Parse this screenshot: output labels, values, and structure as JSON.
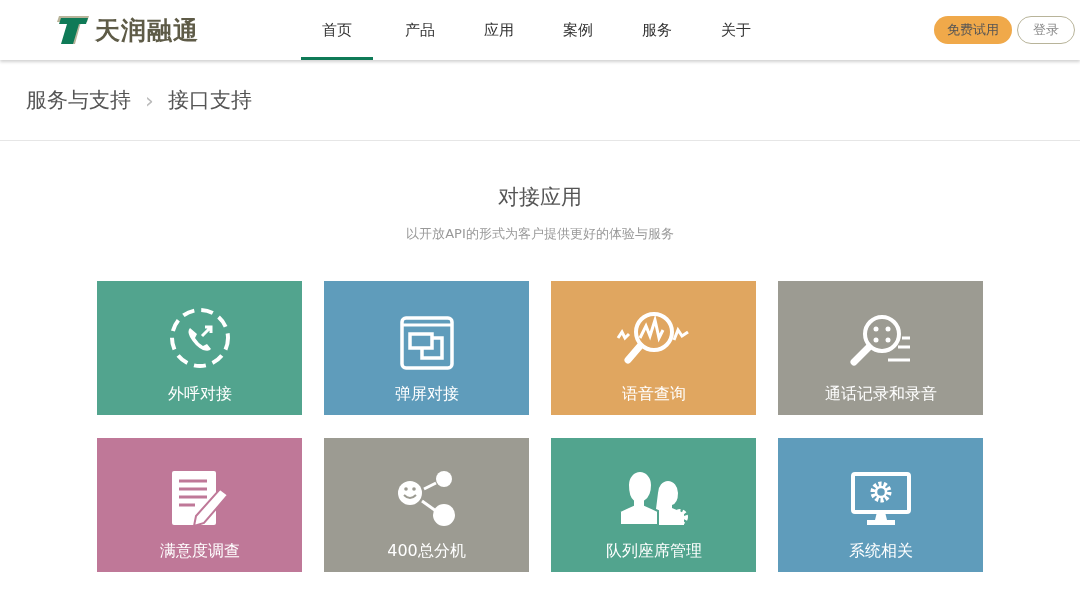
{
  "logo": {
    "text": "天润融通"
  },
  "nav": [
    {
      "label": "首页",
      "selected": true
    },
    {
      "label": "产品",
      "selected": false
    },
    {
      "label": "应用",
      "selected": false
    },
    {
      "label": "案例",
      "selected": false
    },
    {
      "label": "服务",
      "selected": false
    },
    {
      "label": "关于",
      "selected": false
    }
  ],
  "actions": {
    "trial": "免费试用",
    "login": "登录"
  },
  "breadcrumb": {
    "parent": "服务与支持",
    "separator": "›",
    "current": "接口支持"
  },
  "section": {
    "title": "对接应用",
    "subtitle": "以开放API的形式为客户提供更好的体验与服务"
  },
  "tiles": [
    {
      "label": "外呼对接",
      "kind": "phone",
      "color": "#52a48e"
    },
    {
      "label": "弹屏对接",
      "kind": "window",
      "color": "#5f9cbb"
    },
    {
      "label": "语音查询",
      "kind": "voice",
      "color": "#e0a660"
    },
    {
      "label": "通话记录和录音",
      "kind": "record",
      "color": "#9c9b92"
    },
    {
      "label": "满意度调查",
      "kind": "survey",
      "color": "#bf7898"
    },
    {
      "label": "400总分机",
      "kind": "share",
      "color": "#9c9b92"
    },
    {
      "label": "队列座席管理",
      "kind": "agents",
      "color": "#52a48e"
    },
    {
      "label": "系统相关",
      "kind": "system",
      "color": "#5f9cbb"
    }
  ]
}
